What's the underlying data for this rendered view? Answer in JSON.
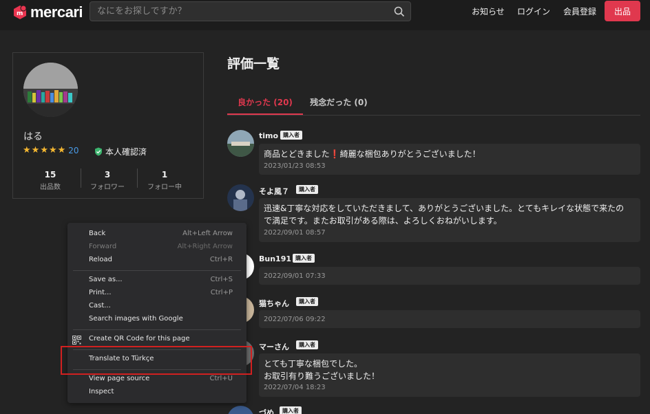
{
  "header": {
    "logo_text": "mercari",
    "search_placeholder": "なにをお探しですか？",
    "nav": {
      "notifications": "お知らせ",
      "login": "ログイン",
      "register": "会員登録",
      "sell": "出品"
    },
    "colors": {
      "brand": "#e0384e",
      "background": "#1c1c1c"
    }
  },
  "profile": {
    "name": "はる",
    "rating_stars": 5,
    "rating_count": "20",
    "verified_label": "本人確認済",
    "stats": [
      {
        "value": "15",
        "label": "出品数"
      },
      {
        "value": "3",
        "label": "フォロワー"
      },
      {
        "value": "1",
        "label": "フォロー中"
      }
    ]
  },
  "main": {
    "title": "評価一覧",
    "tabs": [
      {
        "label": "良かった (20)",
        "active": true
      },
      {
        "label": "残念だった (0)",
        "active": false
      }
    ],
    "buyer_badge": "購入者",
    "reviews": [
      {
        "name": "timo",
        "text_before": "商品とどきました",
        "text_mark": "❗",
        "text_after": "綺麗な梱包ありがとうございました！",
        "date": "2023/01/23 08:53"
      },
      {
        "name": "そよ風７",
        "text_line1": "迅速&丁寧な対応をしていただきまして、ありがとうございました。とてもキレイな状態で来たの",
        "text_line2": "で満足です。またお取引がある際は、よろしくおねがいします。",
        "date": "2022/09/01 08:57"
      },
      {
        "name": "Bun191",
        "date": "2022/09/01 07:33"
      },
      {
        "name": "猫ちゃん",
        "date": "2022/07/06 09:22"
      },
      {
        "name": "マーさん",
        "text_line1": "とても丁寧な梱包でした。",
        "text_line2": "お取引有り難うございました！",
        "date": "2022/07/04 18:23"
      },
      {
        "name": "づめ"
      }
    ]
  },
  "context_menu": {
    "items": [
      {
        "label": "Back",
        "shortcut": "Alt+Left Arrow"
      },
      {
        "label": "Forward",
        "shortcut": "Alt+Right Arrow"
      },
      {
        "label": "Reload",
        "shortcut": "Ctrl+R"
      },
      {
        "label": "Save as...",
        "shortcut": "Ctrl+S"
      },
      {
        "label": "Print...",
        "shortcut": "Ctrl+P"
      },
      {
        "label": "Cast..."
      },
      {
        "label": "Search images with Google"
      },
      {
        "label": "Create QR Code for this page"
      },
      {
        "label": "Translate to Türkçe"
      },
      {
        "label": "View page source",
        "shortcut": "Ctrl+U"
      },
      {
        "label": "Inspect"
      }
    ],
    "highlight_color": "#d22020"
  }
}
